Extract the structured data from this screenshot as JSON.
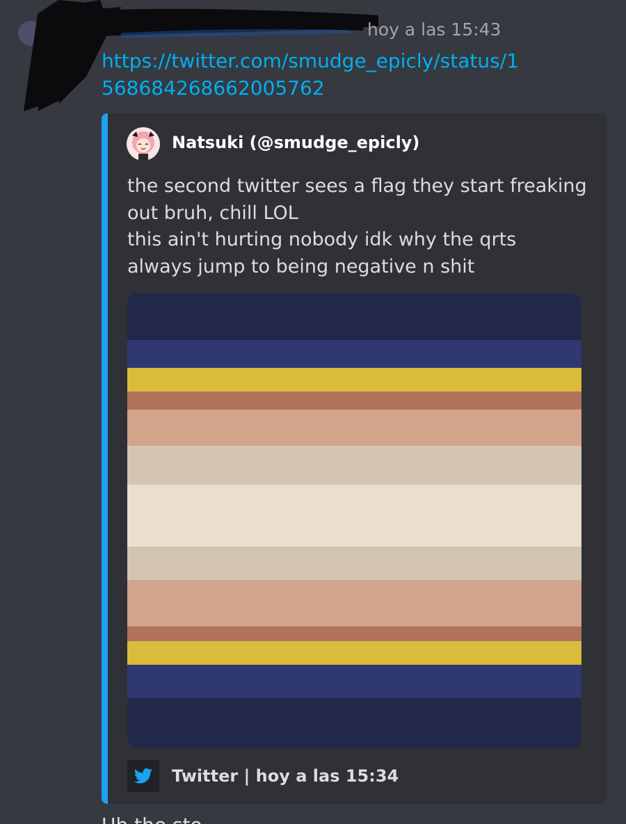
{
  "message": {
    "timestamp": "hoy a las 15:43",
    "link": "https://twitter.com/smudge_epicly/status/1568684268662005762",
    "next_message_partial": "Uh the sto..."
  },
  "embed": {
    "accent_color": "#1da1f2",
    "author": "Natsuki (@smudge_epicly)",
    "text_lines": [
      "the second twitter sees a flag they start freaking",
      "out bruh, chill LOL",
      "this ain't hurting nobody idk why the qrts",
      "always jump to being negative n shit"
    ],
    "footer_icon": "twitter-bird-icon",
    "footer": "Twitter | hoy a las 15:34"
  },
  "flag_image": {
    "stripes": [
      {
        "color": "#222849",
        "frac": 0.102
      },
      {
        "color": "#2f3871",
        "frac": 0.061
      },
      {
        "color": "#d9bc3b",
        "frac": 0.052
      },
      {
        "color": "#b2735b",
        "frac": 0.04
      },
      {
        "color": "#d1a48b",
        "frac": 0.08
      },
      {
        "color": "#d4c5b0",
        "frac": 0.086
      },
      {
        "color": "#eadfcf",
        "frac": 0.136
      },
      {
        "color": "#d4c5b0",
        "frac": 0.073
      },
      {
        "color": "#d1a48b",
        "frac": 0.102
      },
      {
        "color": "#b2735b",
        "frac": 0.032
      },
      {
        "color": "#d9bc3b",
        "frac": 0.052
      },
      {
        "color": "#2f3871",
        "frac": 0.073
      },
      {
        "color": "#222849",
        "frac": 0.111
      }
    ]
  }
}
